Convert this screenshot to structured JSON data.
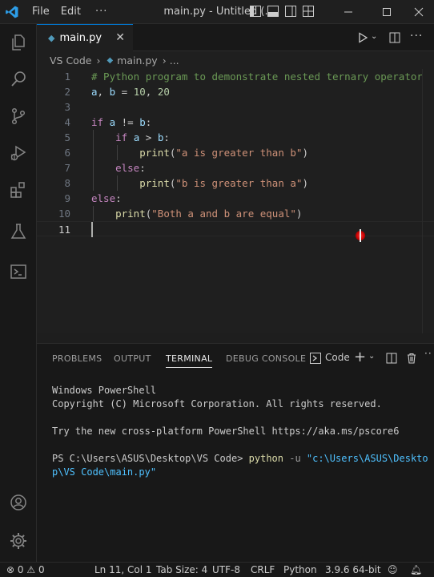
{
  "titlebar": {
    "menu_file": "File",
    "menu_edit": "Edit",
    "overflow": "···",
    "title": "main.py - Untitled (..."
  },
  "tab": {
    "label": "main.py",
    "icon": "python-file-icon",
    "close": "✕"
  },
  "breadcrumb": {
    "folder": "VS Code",
    "file": "main.py",
    "more": "..."
  },
  "editor": {
    "lines": [
      {
        "n": "1",
        "html": "<span class=\"cm\"># Python program to demonstrate nested ternary operator</span>"
      },
      {
        "n": "2",
        "html": "<span class=\"var\">a</span>, <span class=\"var\">b</span> = <span class=\"num\">10</span>, <span class=\"num\">20</span>"
      },
      {
        "n": "3",
        "html": ""
      },
      {
        "n": "4",
        "html": "<span class=\"kw\">if</span> <span class=\"var\">a</span> != <span class=\"var\">b</span>:"
      },
      {
        "n": "5",
        "html": "    <span class=\"kw\">if</span> <span class=\"var\">a</span> &gt; <span class=\"var\">b</span>:"
      },
      {
        "n": "6",
        "html": "        <span class=\"fn\">print</span>(<span class=\"str\">\"a is greater than b\"</span>)"
      },
      {
        "n": "7",
        "html": "    <span class=\"kw\">else</span>:"
      },
      {
        "n": "8",
        "html": "        <span class=\"fn\">print</span>(<span class=\"str\">\"b is greater than a\"</span>)"
      },
      {
        "n": "9",
        "html": "<span class=\"kw\">else</span>:"
      },
      {
        "n": "10",
        "html": "    <span class=\"fn\">print</span>(<span class=\"str\">\"Both a and b are equal\"</span>)"
      },
      {
        "n": "11",
        "html": ""
      }
    ],
    "active_line": "11"
  },
  "panel": {
    "tabs": [
      "PROBLEMS",
      "OUTPUT",
      "TERMINAL",
      "DEBUG CONSOLE"
    ],
    "active_tab": "TERMINAL",
    "shell_label": "Code",
    "terminal": {
      "line1": "Windows PowerShell",
      "line2": "Copyright (C) Microsoft Corporation. All rights reserved.",
      "line3": "Try the new cross-platform PowerShell https://aka.ms/pscore6",
      "prompt": "PS C:\\Users\\ASUS\\Desktop\\VS Code> ",
      "cmd": "python",
      "flag": " -u ",
      "path1": "\"c:\\Users\\ASUS\\Deskto",
      "path2": "p\\VS Code\\main.py\""
    }
  },
  "statusbar": {
    "errors": "0",
    "warnings": "0",
    "position": "Ln 11, Col 1",
    "tab_size": "Tab Size: 4",
    "encoding": "UTF-8",
    "eol": "CRLF",
    "language": "Python",
    "interpreter": "3.9.6 64-bit"
  },
  "colors": {
    "accent": "#0078d4",
    "python_blue": "#519aba"
  }
}
